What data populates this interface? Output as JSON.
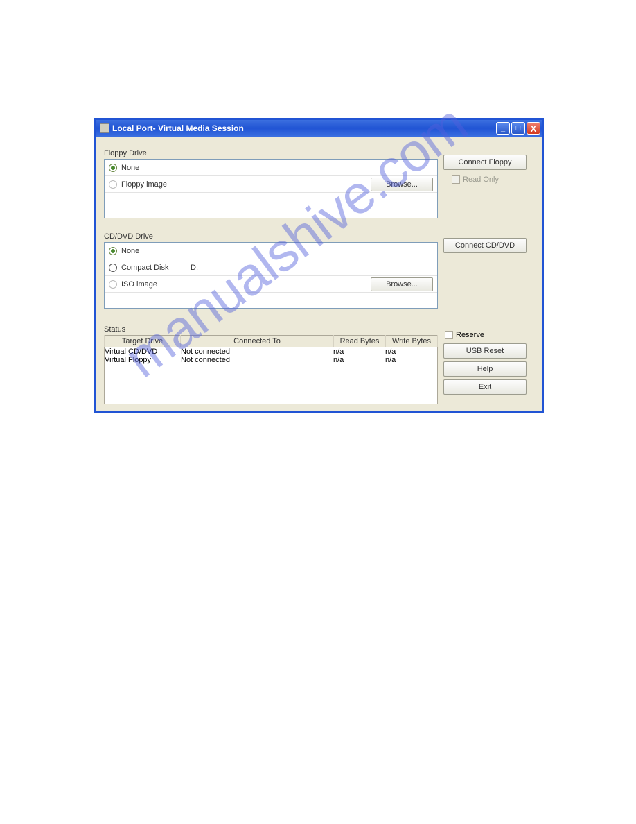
{
  "window": {
    "title": "Local Port- Virtual Media Session"
  },
  "floppy": {
    "label": "Floppy Drive",
    "none": "None",
    "image": "Floppy image",
    "browse": "Browse...",
    "connect": "Connect Floppy",
    "readonly": "Read Only"
  },
  "cdvd": {
    "label": "CD/DVD Drive",
    "none": "None",
    "compact": "Compact Disk",
    "compact_drive": "D:",
    "iso": "ISO image",
    "browse": "Browse...",
    "connect": "Connect CD/DVD"
  },
  "status": {
    "label": "Status",
    "headers": {
      "target": "Target Drive",
      "connected": "Connected To",
      "read": "Read Bytes",
      "write": "Write Bytes"
    },
    "rows": [
      {
        "target": "Virtual CD/DVD",
        "connected": "Not connected",
        "read": "n/a",
        "write": "n/a"
      },
      {
        "target": "Virtual Floppy",
        "connected": "Not connected",
        "read": "n/a",
        "write": "n/a"
      }
    ]
  },
  "side": {
    "reserve": "Reserve",
    "usb_reset": "USB Reset",
    "help": "Help",
    "exit": "Exit"
  },
  "watermark": "manualshive.com"
}
